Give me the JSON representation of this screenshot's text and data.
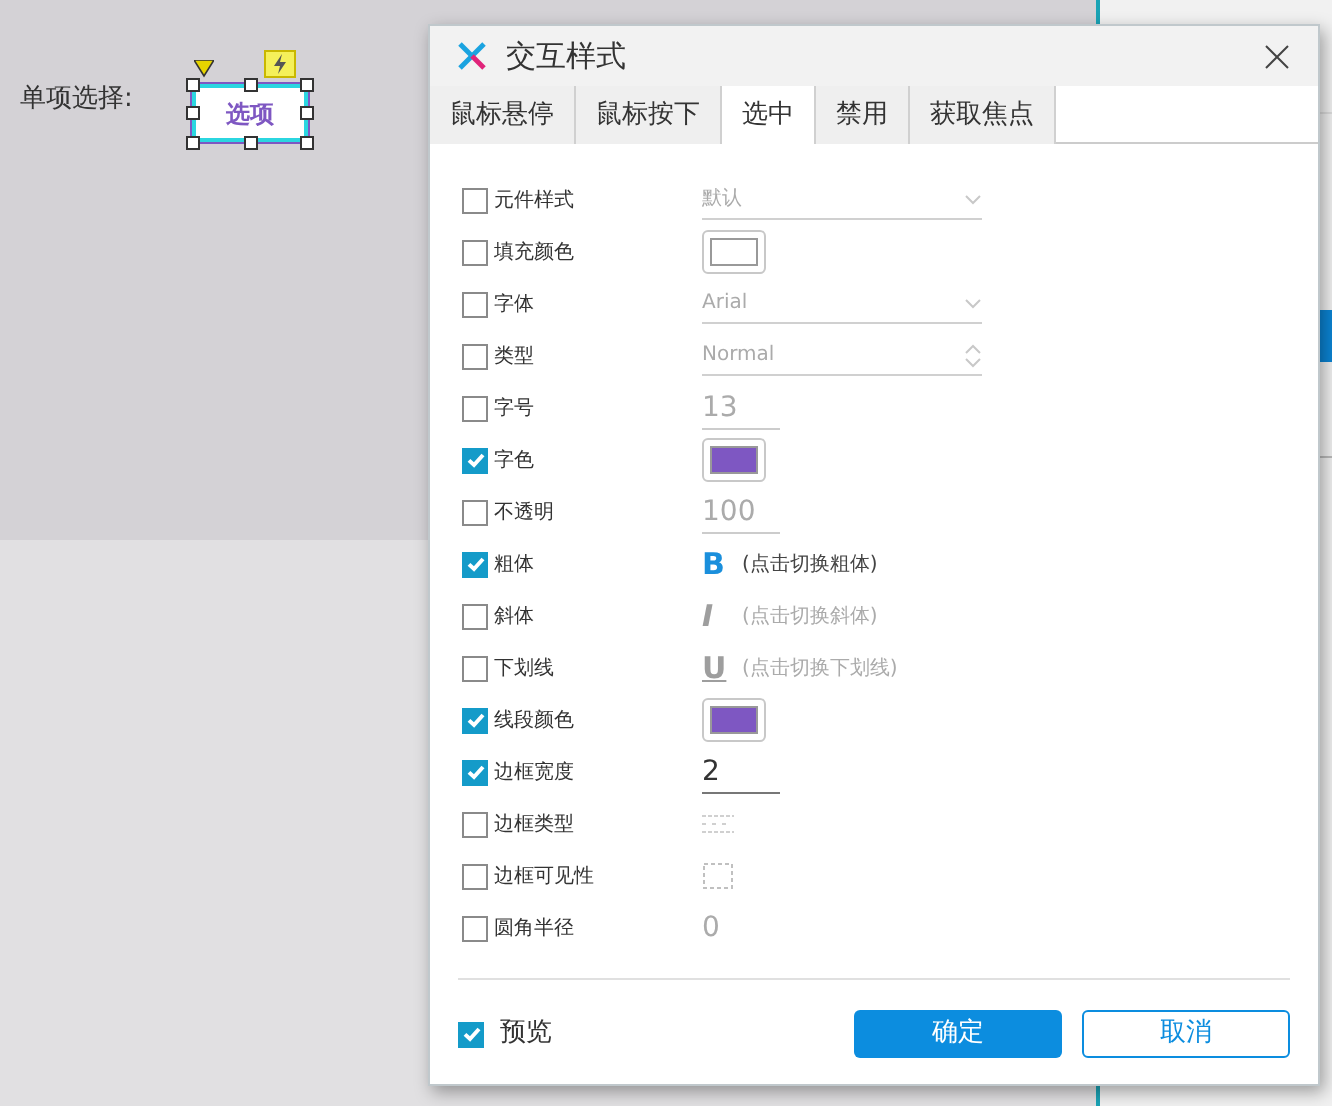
{
  "canvas": {
    "label": "单项选择:",
    "widget": {
      "text": "选项",
      "selected": true
    }
  },
  "dialog": {
    "title": "交互样式",
    "tabs": [
      {
        "label": "鼠标悬停",
        "selected": false
      },
      {
        "label": "鼠标按下",
        "selected": false
      },
      {
        "label": "选中",
        "selected": true
      },
      {
        "label": "禁用",
        "selected": false
      },
      {
        "label": "获取焦点",
        "selected": false
      }
    ],
    "rows": [
      {
        "label": "元件样式",
        "checked": false,
        "kind": "select",
        "value": "默认"
      },
      {
        "label": "填充颜色",
        "checked": false,
        "kind": "color",
        "color": "#ffffff"
      },
      {
        "label": "字体",
        "checked": false,
        "kind": "select",
        "value": "Arial"
      },
      {
        "label": "类型",
        "checked": false,
        "kind": "spinner",
        "value": "Normal"
      },
      {
        "label": "字号",
        "checked": false,
        "kind": "number",
        "value": "13"
      },
      {
        "label": "字色",
        "checked": true,
        "kind": "color",
        "color": "#7e57c2"
      },
      {
        "label": "不透明",
        "checked": false,
        "kind": "number",
        "value": "100"
      },
      {
        "label": "粗体",
        "checked": true,
        "kind": "toggle",
        "icon": "B",
        "hint": "(点击切换粗体)"
      },
      {
        "label": "斜体",
        "checked": false,
        "kind": "toggle",
        "icon": "I",
        "hint": "(点击切换斜体)"
      },
      {
        "label": "下划线",
        "checked": false,
        "kind": "toggle",
        "icon": "U",
        "hint": "(点击切换下划线)"
      },
      {
        "label": "线段颜色",
        "checked": true,
        "kind": "color",
        "color": "#7e57c2"
      },
      {
        "label": "边框宽度",
        "checked": true,
        "kind": "number",
        "value": "2"
      },
      {
        "label": "边框类型",
        "checked": false,
        "kind": "linestyle"
      },
      {
        "label": "边框可见性",
        "checked": false,
        "kind": "visibility"
      },
      {
        "label": "圆角半径",
        "checked": false,
        "kind": "number",
        "value": "0"
      }
    ],
    "preview": {
      "label": "预览",
      "checked": true
    },
    "buttons": [
      {
        "label": "确定",
        "kind": "primary"
      },
      {
        "label": "取消",
        "kind": "secondary"
      }
    ]
  }
}
